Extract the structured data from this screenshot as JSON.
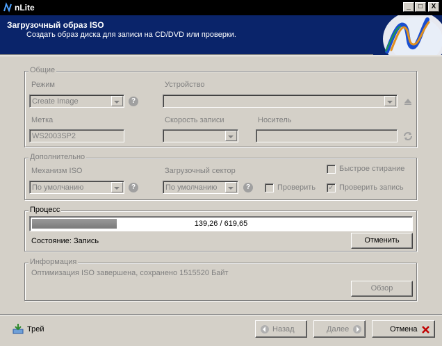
{
  "window": {
    "title": "nLite",
    "min": "_",
    "max": "□",
    "close": "X"
  },
  "header": {
    "title": "Загрузочный образ ISO",
    "subtitle": "Создать образ диска для записи на CD/DVD или проверки."
  },
  "general": {
    "legend": "Общие",
    "mode_label": "Режим",
    "mode_value": "Create Image",
    "device_label": "Устройство",
    "device_value": "",
    "label_label": "Метка",
    "label_value": "WS2003SP2",
    "speed_label": "Скорость записи",
    "speed_value": "",
    "media_label": "Носитель",
    "media_value": ""
  },
  "advanced": {
    "legend": "Дополнительно",
    "iso_engine_label": "Механизм ISO",
    "iso_engine_value": "По умолчанию",
    "boot_sector_label": "Загрузочный сектор",
    "boot_sector_value": "По умолчанию",
    "quick_erase_label": "Быстрое стирание",
    "quick_erase_checked": false,
    "verify_label": "Проверить",
    "verify_checked": false,
    "verify_burn_label": "Проверить запись",
    "verify_burn_checked": true
  },
  "process": {
    "legend": "Процесс",
    "progress_text": "139,26 / 619,65",
    "progress_fraction": 0.2247,
    "status_label": "Состояние:",
    "status_value": "Запись",
    "cancel_label": "Отменить"
  },
  "info": {
    "legend": "Информация",
    "text": "Оптимизация ISO завершена, сохранено 1515520 Байт",
    "browse_label": "Обзор"
  },
  "footer": {
    "tray_label": "Трей",
    "back_label": "Назад",
    "next_label": "Далее",
    "cancel_label": "Отмена"
  },
  "icons": {
    "help": "?",
    "checkmark": "✓"
  },
  "colors": {
    "header_bg": "#0a246a",
    "window_bg": "#d4d0c8",
    "cancel_x": "#c00000"
  }
}
